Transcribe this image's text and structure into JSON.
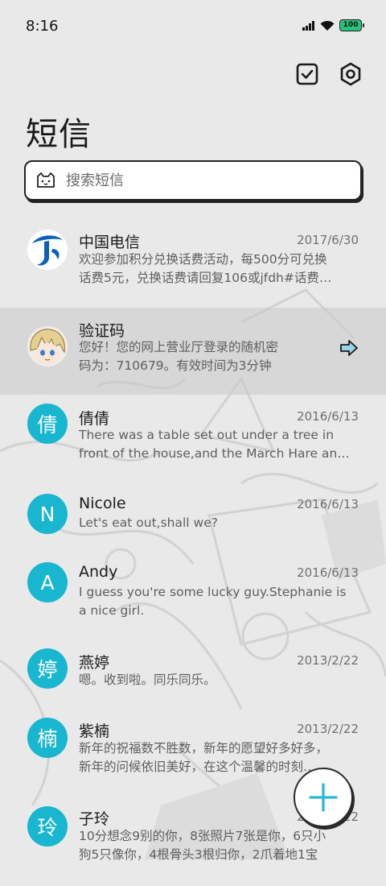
{
  "status": {
    "time": "8:16",
    "battery": "100"
  },
  "icons": {
    "signal": "signal-icon",
    "wifi": "wifi-icon",
    "battery": "battery-icon",
    "select": "checkbox-icon",
    "settings": "settings-icon",
    "search": "search-cat-icon",
    "share": "share-arrow-icon",
    "add": "plus-icon"
  },
  "page": {
    "title": "短信"
  },
  "search": {
    "placeholder": "搜索短信"
  },
  "conversations": [
    {
      "name": "中国电信",
      "date": "2017/6/30",
      "avatar": "telecom-logo",
      "line1": "欢迎参加积分兑换话费活动，每500分可兑换",
      "line2": "话费5元，兑换话费请回复106或jfdh#话费…"
    },
    {
      "name": "验证码",
      "date": "",
      "avatar": "anime-avatar",
      "line1": "您好！您的网上营业厅登录的随机密",
      "line2": "码为：710679。有效时间为3分钟"
    },
    {
      "name": "倩倩",
      "date": "2016/6/13",
      "avatar_text": "倩",
      "line1": "There was a table set out under a tree in",
      "line2": "front of the house,and the March Hare an…"
    },
    {
      "name": "Nicole",
      "date": "2016/6/13",
      "avatar_text": "N",
      "line1": "Let's eat out,shall we?",
      "line2": ""
    },
    {
      "name": "Andy",
      "date": "2016/6/13",
      "avatar_text": "A",
      "line1": "I guess you're some lucky guy.Stephanie is",
      "line2": "a nice girl."
    },
    {
      "name": "燕婷",
      "date": "2013/2/22",
      "avatar_text": "婷",
      "line1": "嗯。收到啦。同乐同乐。",
      "line2": ""
    },
    {
      "name": "紫楠",
      "date": "2013/2/22",
      "avatar_text": "楠",
      "line1": "新年的祝福数不胜数，新年的愿望好多好多，",
      "line2": "新年的问候依旧美好，在这个温馨的时刻…"
    },
    {
      "name": "子玲",
      "date": "2013/2/22",
      "avatar_text": "玲",
      "line1": "10分想念9别的你，8张照片7张是你，6只小",
      "line2": "狗5只像你，4根骨头3根归你，2爪着地1宝"
    }
  ],
  "colors": {
    "accent": "#19b6cf",
    "fab_plus": "#2bb7d6",
    "battery": "#27c37a"
  }
}
